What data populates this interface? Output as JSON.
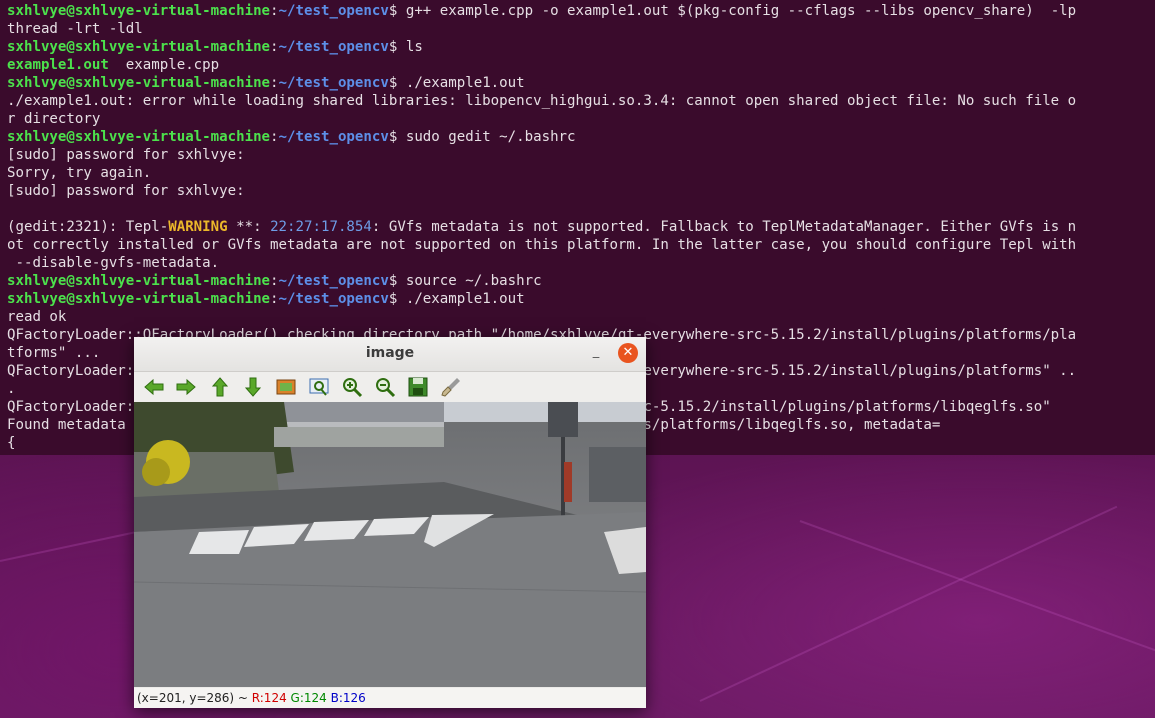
{
  "terminal": {
    "lines": [
      [
        [
          "g",
          "sxhlvye@sxhlvye-virtual-machine"
        ],
        [
          "n",
          ":"
        ],
        [
          "b",
          "~/test_opencv"
        ],
        [
          "n",
          "$ g++ example.cpp -o example1.out $(pkg-config --cflags --libs opencv_share)  -lp"
        ]
      ],
      [
        [
          "n",
          "thread -lrt -ldl"
        ]
      ],
      [
        [
          "g",
          "sxhlvye@sxhlvye-virtual-machine"
        ],
        [
          "n",
          ":"
        ],
        [
          "b",
          "~/test_opencv"
        ],
        [
          "n",
          "$ ls"
        ]
      ],
      [
        [
          "g",
          "example1.out"
        ],
        [
          "n",
          "  example.cpp"
        ]
      ],
      [
        [
          "g",
          "sxhlvye@sxhlvye-virtual-machine"
        ],
        [
          "n",
          ":"
        ],
        [
          "b",
          "~/test_opencv"
        ],
        [
          "n",
          "$ ./example1.out"
        ]
      ],
      [
        [
          "n",
          "./example1.out: error while loading shared libraries: libopencv_highgui.so.3.4: cannot open shared object file: No such file o"
        ]
      ],
      [
        [
          "n",
          "r directory"
        ]
      ],
      [
        [
          "g",
          "sxhlvye@sxhlvye-virtual-machine"
        ],
        [
          "n",
          ":"
        ],
        [
          "b",
          "~/test_opencv"
        ],
        [
          "n",
          "$ sudo gedit ~/.bashrc"
        ]
      ],
      [
        [
          "n",
          "[sudo] password for sxhlvye:"
        ]
      ],
      [
        [
          "n",
          "Sorry, try again."
        ]
      ],
      [
        [
          "n",
          "[sudo] password for sxhlvye:"
        ]
      ],
      [
        [
          "n",
          ""
        ]
      ],
      [
        [
          "n",
          "(gedit:2321): Tepl-"
        ],
        [
          "y",
          "WARNING"
        ],
        [
          "n",
          " **: "
        ],
        [
          "t",
          "22:27:17.854"
        ],
        [
          "n",
          ": GVfs metadata is not supported. Fallback to TeplMetadataManager. Either GVfs is n"
        ]
      ],
      [
        [
          "n",
          "ot correctly installed or GVfs metadata are not supported on this platform. In the latter case, you should configure Tepl with"
        ]
      ],
      [
        [
          "n",
          " --disable-gvfs-metadata."
        ]
      ],
      [
        [
          "g",
          "sxhlvye@sxhlvye-virtual-machine"
        ],
        [
          "n",
          ":"
        ],
        [
          "b",
          "~/test_opencv"
        ],
        [
          "n",
          "$ source ~/.bashrc"
        ]
      ],
      [
        [
          "g",
          "sxhlvye@sxhlvye-virtual-machine"
        ],
        [
          "n",
          ":"
        ],
        [
          "b",
          "~/test_opencv"
        ],
        [
          "n",
          "$ ./example1.out"
        ]
      ],
      [
        [
          "n",
          "read ok"
        ]
      ],
      [
        [
          "n",
          "QFactoryLoader::QFactoryLoader() checking directory path \"/home/sxhlvye/qt-everywhere-src-5.15.2/install/plugins/platforms/pla"
        ]
      ],
      [
        [
          "n",
          "tforms\" ..."
        ]
      ],
      [
        [
          "n",
          "QFactoryLoader::QFactoryLoader() checking directory path \"/home/sxhlvye/qt-everywhere-src-5.15.2/install/plugins/platforms\" .."
        ]
      ],
      [
        [
          "n",
          "."
        ]
      ],
      [
        [
          "n",
          "QFactoryLoader::QFactoryLoader() looking at \"/home/sxhlvye/qt-everywhere-src-5.15.2/install/plugins/platforms/libqeglfs.so\""
        ]
      ],
      [
        [
          "n",
          "Found metadata in lib /home/sxhlvye/qt-everywhere-src-5.15.2/install/plugins/platforms/libqeglfs.so, metadata="
        ]
      ],
      [
        [
          "n",
          "{"
        ]
      ]
    ]
  },
  "image_window": {
    "title": "image",
    "minimize_glyph": "_",
    "close_glyph": "✕",
    "toolbar": [
      "arrow-left-icon",
      "arrow-right-icon",
      "arrow-up-icon",
      "arrow-down-icon",
      "zoom-fit-icon",
      "zoom-rect-icon",
      "zoom-in-icon",
      "zoom-out-icon",
      "save-icon",
      "properties-icon"
    ],
    "status": {
      "coords": "(x=201, y=286) ~ ",
      "r": "R:124",
      "g": "G:124",
      "b": "B:126"
    }
  },
  "colors": {
    "prompt_user": "#4ce24c",
    "prompt_path": "#5d8fe8",
    "warning": "#ecb82a",
    "close_button": "#e9541f"
  }
}
